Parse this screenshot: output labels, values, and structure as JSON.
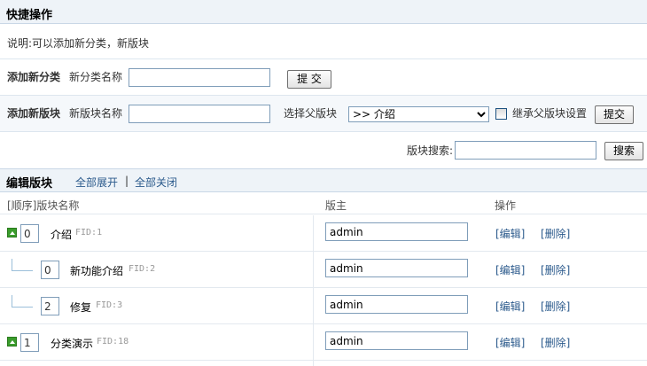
{
  "quick_ops": {
    "title": "快捷操作",
    "note": "说明:可以添加新分类，新版块"
  },
  "add_category": {
    "label": "添加新分类",
    "name_label": "新分类名称",
    "name_value": "",
    "submit": "提 交"
  },
  "add_forum": {
    "label": "添加新版块",
    "name_label": "新版块名称",
    "name_value": "",
    "parent_label": "选择父版块",
    "parent_selected": ">> 介绍",
    "inherit_label": "继承父版块设置",
    "inherit_checked": false,
    "submit": "提交"
  },
  "search": {
    "label": "版块搜索:",
    "value": "",
    "button": "搜索"
  },
  "edit": {
    "title": "编辑版块",
    "expand_all": "全部展开",
    "separator": "|",
    "collapse_all": "全部关闭"
  },
  "table": {
    "col_name": "[顺序]版块名称",
    "col_mod": "版主",
    "col_ops": "操作",
    "rows": [
      {
        "order": "0",
        "name": "介绍",
        "fid": "FID:1",
        "moderator": "admin",
        "edit": "[编辑]",
        "delete": "[删除]",
        "is_category": true
      },
      {
        "order": "0",
        "name": "新功能介绍",
        "fid": "FID:2",
        "moderator": "admin",
        "edit": "[编辑]",
        "delete": "[删除]",
        "is_category": false
      },
      {
        "order": "2",
        "name": "修复",
        "fid": "FID:3",
        "moderator": "admin",
        "edit": "[编辑]",
        "delete": "[删除]",
        "is_category": false
      },
      {
        "order": "1",
        "name": "分类演示",
        "fid": "FID:18",
        "moderator": "admin",
        "edit": "[编辑]",
        "delete": "[删除]",
        "is_category": true
      }
    ]
  },
  "colors": {
    "header_bg": "#eef3f8",
    "link": "#2b5a8c",
    "toggle_green": "#3a9c2c"
  }
}
